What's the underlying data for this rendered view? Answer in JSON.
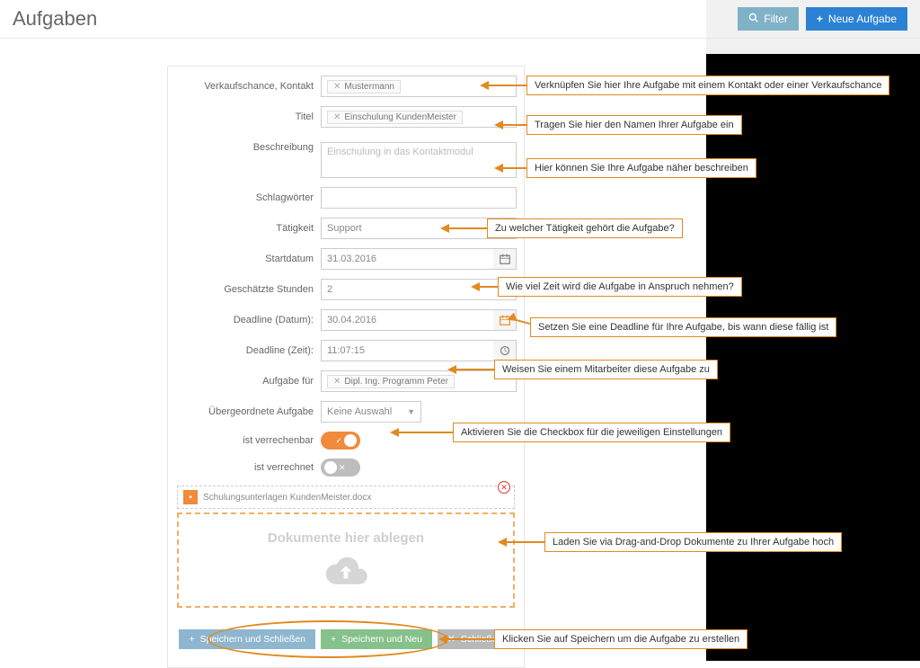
{
  "header": {
    "title": "Aufgaben",
    "filter_btn": "Filter",
    "new_btn": "Neue Aufgabe"
  },
  "form": {
    "labels": {
      "contact": "Verkaufschance, Kontakt",
      "title": "Titel",
      "description": "Beschreibung",
      "tags": "Schlagwörter",
      "activity": "Tätigkeit",
      "start_date": "Startdatum",
      "est_hours": "Geschätzte Stunden",
      "deadline_date": "Deadline (Datum):",
      "deadline_time": "Deadline (Zeit):",
      "assignee": "Aufgabe für",
      "parent": "Übergeordnete Aufgabe",
      "billable": "ist verrechenbar",
      "billed": "ist verrechnet"
    },
    "values": {
      "contact_tag": "Mustermann",
      "title_tag": "Einschulung KundenMeister",
      "description_placeholder": "Einschulung in das Kontaktmodul",
      "activity": "Support",
      "start_date": "31.03.2016",
      "est_hours": "2",
      "deadline_date": "30.04.2016",
      "deadline_time": "11:07:15",
      "assignee_tag": "Dipl. Ing. Programm Peter",
      "parent": "Keine Auswahl"
    },
    "toggles": {
      "billable_on": true,
      "billed_on": false
    },
    "file": {
      "name": "Schulungsunterlagen KundenMeister.docx"
    },
    "drop_zone_label": "Dokumente hier ablegen"
  },
  "footer": {
    "save_close": "Speichern und Schließen",
    "save_new": "Speichern und Neu",
    "close": "Schließen"
  },
  "callouts": {
    "c1": "Verknüpfen Sie hier Ihre Aufgabe mit einem Kontakt oder einer Verkaufschance",
    "c2": "Tragen Sie hier den Namen Ihrer Aufgabe ein",
    "c3": "Hier können Sie Ihre Aufgabe näher beschreiben",
    "c4": "Zu welcher Tätigkeit gehört die Aufgabe?",
    "c5": "Wie viel Zeit wird die Aufgabe in Anspruch nehmen?",
    "c6": "Setzen Sie eine Deadline für Ihre Aufgabe, bis wann diese fällig ist",
    "c7": "Weisen Sie einem Mitarbeiter diese Aufgabe zu",
    "c8": "Aktivieren Sie die Checkbox für die jeweiligen Einstellungen",
    "c9": "Laden Sie via Drag-and-Drop Dokumente  zu Ihrer Aufgabe hoch",
    "c10": "Klicken Sie auf Speichern um die Aufgabe zu erstellen"
  }
}
